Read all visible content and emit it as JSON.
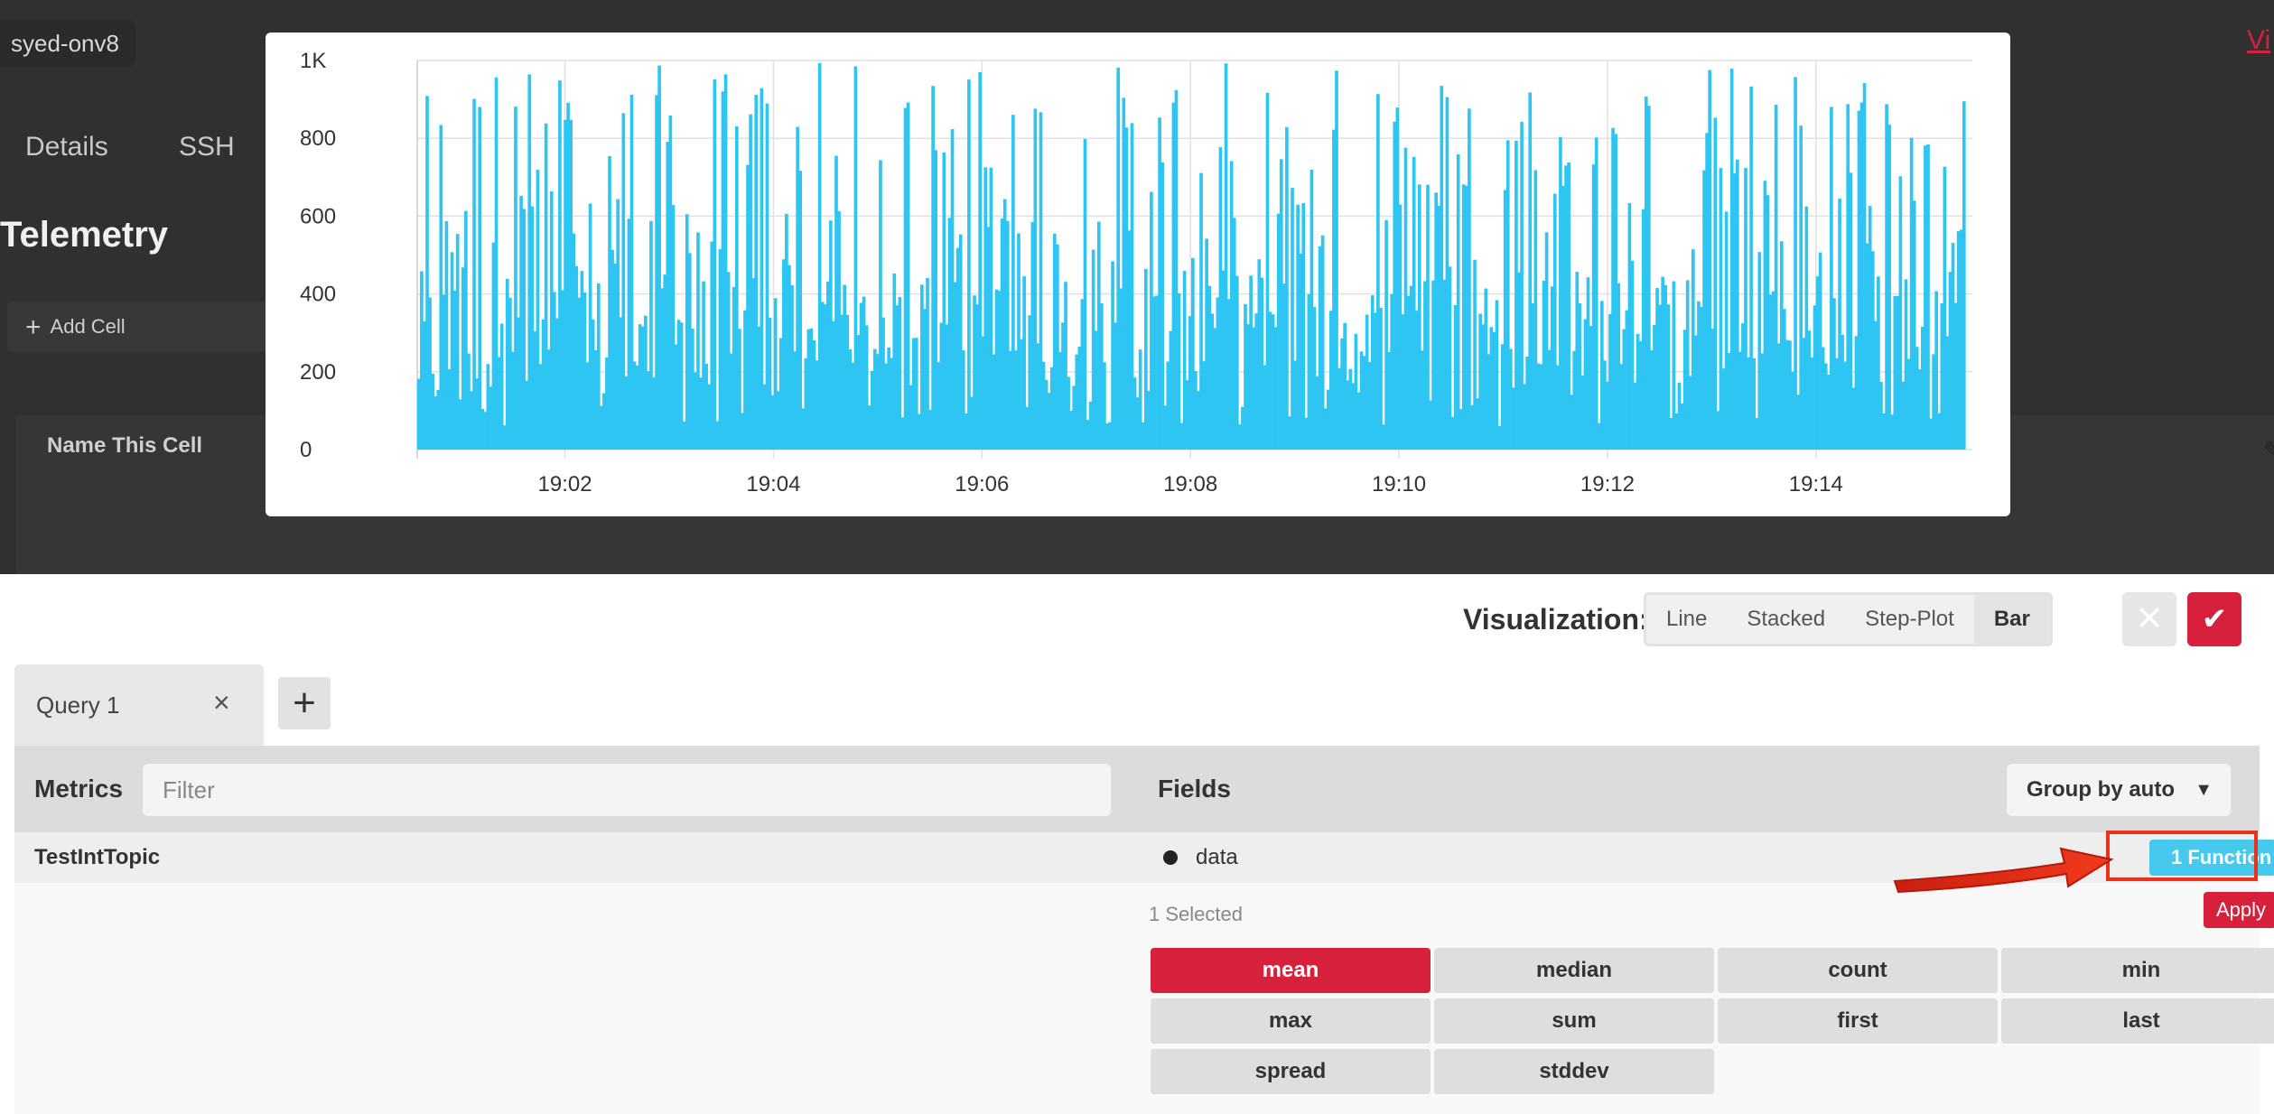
{
  "background": {
    "hostname": "syed-onv8",
    "tabs": [
      "Details",
      "SSH"
    ],
    "page_title": "Telemetry",
    "add_cell_label": "Add Cell",
    "cell_name": "Name This Cell",
    "top_right_link": "Vi"
  },
  "chart_data": {
    "type": "bar",
    "color": "#2ec5f2",
    "ylim": [
      0,
      1000
    ],
    "yticks": [
      "0",
      "200",
      "400",
      "600",
      "800",
      "1K"
    ],
    "xticks": [
      "19:02",
      "19:04",
      "19:06",
      "19:08",
      "19:10",
      "19:12",
      "19:14"
    ],
    "x_range": [
      "19:00:35",
      "19:15:30"
    ],
    "note_values": "dense bars ranging roughly 0-1000"
  },
  "editor": {
    "visualization_label": "Visualization:",
    "visualization_options": [
      "Line",
      "Stacked",
      "Step-Plot",
      "Bar"
    ],
    "visualization_selected": "Bar",
    "query_tab": "Query 1",
    "metrics": {
      "title": "Metrics",
      "filter_placeholder": "Filter",
      "items": [
        "TestIntTopic"
      ]
    },
    "fields": {
      "title": "Fields",
      "group_by": "Group by auto",
      "items": [
        {
          "name": "data",
          "function_label": "1 Function"
        }
      ],
      "selected_count": "1 Selected",
      "apply_label": "Apply",
      "functions": [
        "mean",
        "median",
        "count",
        "min",
        "max",
        "sum",
        "first",
        "last",
        "spread",
        "stddev"
      ],
      "active_function": "mean"
    }
  },
  "annotation": {
    "arrow_color": "#e8321c"
  }
}
